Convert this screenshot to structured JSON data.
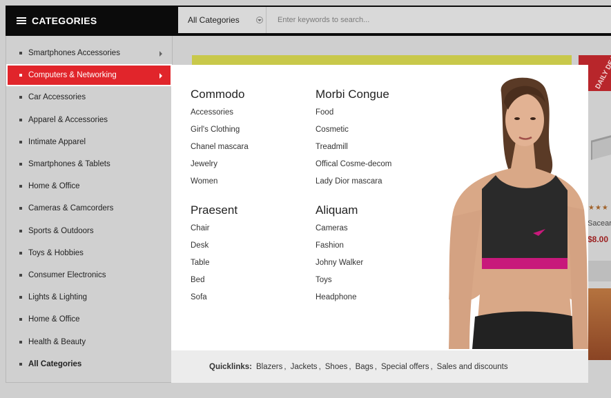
{
  "header": {
    "categories_title": "CATEGORIES",
    "list_icon": "list-icon"
  },
  "search": {
    "category_value": "All Categories",
    "placeholder": "Enter keywords to search..."
  },
  "sidebar": {
    "items": [
      {
        "label": "Smartphones Accessories",
        "arrow": true
      },
      {
        "label": "Computers & Networking",
        "arrow": true,
        "active": true
      },
      {
        "label": "Car Accessories"
      },
      {
        "label": "Apparel & Accessories"
      },
      {
        "label": "Intimate Apparel"
      },
      {
        "label": "Smartphones & Tablets"
      },
      {
        "label": "Home & Office"
      },
      {
        "label": "Cameras & Camcorders"
      },
      {
        "label": "Sports & Outdoors"
      },
      {
        "label": "Toys & Hobbies"
      },
      {
        "label": "Consumer Electronics"
      },
      {
        "label": "Lights & Lighting"
      },
      {
        "label": "Home & Office"
      },
      {
        "label": "Health & Beauty"
      },
      {
        "label": "All Categories",
        "bold": true
      }
    ]
  },
  "mega_menu": {
    "columns": [
      {
        "title": "Commodo",
        "links": [
          "Accessories",
          "Girl's Clothing",
          "Chanel mascara",
          "Jewelry",
          "Women"
        ]
      },
      {
        "title": "Morbi Congue",
        "links": [
          "Food",
          "Cosmetic",
          "Treadmill",
          "Offical Cosme-decom",
          "Lady Dior mascara"
        ]
      },
      {
        "title": "Praesent",
        "links": [
          "Chair",
          "Desk",
          "Table",
          "Bed",
          "Sofa"
        ]
      },
      {
        "title": "Aliquam",
        "links": [
          "Cameras",
          "Fashion",
          "Johny Walker",
          "Toys",
          "Headphone"
        ]
      }
    ],
    "quicklinks": {
      "label": "Quicklinks:",
      "links": [
        "Blazers",
        "Jackets",
        "Shoes",
        "Bags",
        "Special offers",
        "Sales and discounts"
      ]
    }
  },
  "background": {
    "deal_badge": "DAILY DEALS",
    "stars": "★★★",
    "product_name": "Sacear",
    "product_price": "$8.00"
  },
  "colors": {
    "accent": "#e1252b",
    "header_bg": "#0b0b0b"
  }
}
